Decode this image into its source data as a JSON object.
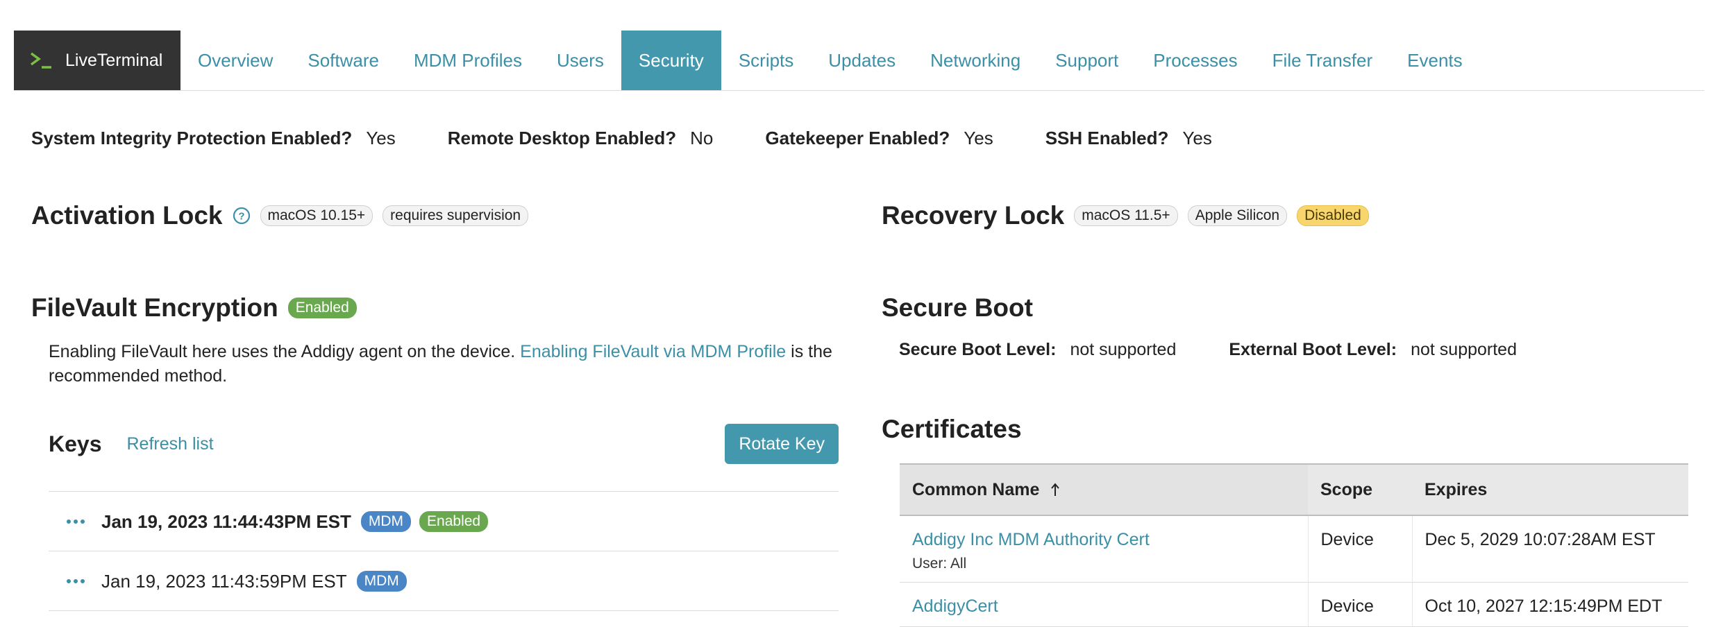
{
  "tabs": {
    "liveterminal": "LiveTerminal",
    "items": [
      "Overview",
      "Software",
      "MDM Profiles",
      "Users",
      "Security",
      "Scripts",
      "Updates",
      "Networking",
      "Support",
      "Processes",
      "File Transfer",
      "Events"
    ],
    "active": "Security"
  },
  "flags": [
    {
      "label": "System Integrity Protection Enabled?",
      "value": "Yes"
    },
    {
      "label": "Remote Desktop Enabled?",
      "value": "No"
    },
    {
      "label": "Gatekeeper Enabled?",
      "value": "Yes"
    },
    {
      "label": "SSH Enabled?",
      "value": "Yes"
    }
  ],
  "activation_lock": {
    "title": "Activation Lock",
    "badges": [
      "macOS 10.15+",
      "requires supervision"
    ]
  },
  "recovery_lock": {
    "title": "Recovery Lock",
    "badges": [
      "macOS 11.5+",
      "Apple Silicon"
    ],
    "status": "Disabled"
  },
  "filevault": {
    "title": "FileVault Encryption",
    "status": "Enabled",
    "text_before": "Enabling FileVault here uses the Addigy agent on the device. ",
    "link": "Enabling FileVault via MDM Profile",
    "text_after": " is the recommended method."
  },
  "keys": {
    "title": "Keys",
    "refresh": "Refresh list",
    "rotate": "Rotate Key",
    "rows": [
      {
        "date": "Jan 19, 2023 11:44:43PM EST",
        "badge": "MDM",
        "status": "Enabled"
      },
      {
        "date": "Jan 19, 2023 11:43:59PM EST",
        "badge": "MDM"
      }
    ]
  },
  "secure_boot": {
    "title": "Secure Boot",
    "level_label": "Secure Boot Level:",
    "level_value": "not supported",
    "external_label": "External Boot Level:",
    "external_value": "not supported"
  },
  "certificates": {
    "title": "Certificates",
    "columns": [
      "Common Name",
      "Scope",
      "Expires"
    ],
    "rows": [
      {
        "name": "Addigy Inc MDM Authority Cert",
        "sub": "User: All",
        "scope": "Device",
        "expires": "Dec 5, 2029 10:07:28AM EST"
      },
      {
        "name": "AddigyCert",
        "scope": "Device",
        "expires": "Oct 10, 2027 12:15:49PM EDT"
      }
    ]
  },
  "colors": {
    "accent": "#4398ad",
    "link": "#3b8fa6",
    "dark_tab": "#333333",
    "green": "#6aa84f",
    "blue": "#4a86c5",
    "yellow": "#f8d66d"
  }
}
